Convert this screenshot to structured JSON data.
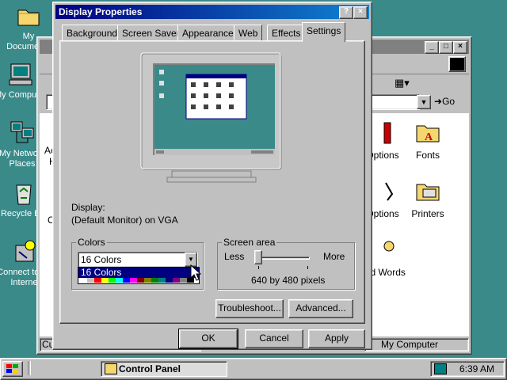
{
  "desktop": {
    "icons": [
      {
        "label": "My Documents"
      },
      {
        "label": "My Computer"
      },
      {
        "label": "My Network Places"
      },
      {
        "label": "Recycle Bin"
      },
      {
        "label": "Connect to the Internet"
      }
    ]
  },
  "control_panel_window": {
    "address_go": "Go",
    "items": [
      {
        "label": "Options"
      },
      {
        "label": "Fonts"
      },
      {
        "label": "Options"
      },
      {
        "label": "Printers"
      },
      {
        "label": "and Words"
      }
    ],
    "left_text_1": "Ac",
    "left_text_2": "H",
    "left_text_3": "C",
    "status_left": "Cus",
    "status_right": "My Computer"
  },
  "dialog": {
    "title": "Display Properties",
    "help_btn": "?",
    "close_btn": "×",
    "tabs": [
      "Background",
      "Screen Saver",
      "Appearance",
      "Web",
      "Effects",
      "Settings"
    ],
    "active_tab": "Settings",
    "display_label": "Display:",
    "display_value": "(Default Monitor) on VGA",
    "colors": {
      "group_label": "Colors",
      "selected": "16 Colors",
      "dropdown_item": "16 Colors",
      "palette": [
        "#ffffff",
        "#c0c0c0",
        "#ff0000",
        "#ffff00",
        "#00ff00",
        "#00ffff",
        "#0000ff",
        "#ff00ff",
        "#800000",
        "#808000",
        "#008000",
        "#008080",
        "#000080",
        "#800080",
        "#808080",
        "#000000"
      ]
    },
    "screen_area": {
      "group_label": "Screen area",
      "less": "Less",
      "more": "More",
      "value": "640 by 480 pixels",
      "slider_position": 0
    },
    "buttons": {
      "troubleshoot": "Troubleshoot...",
      "advanced": "Advanced...",
      "ok": "OK",
      "cancel": "Cancel",
      "apply": "Apply"
    }
  },
  "taskbar": {
    "task": "Control Panel",
    "clock": "6:39 AM"
  },
  "colors": {
    "desktop": "#3a8a8a",
    "title_active": "#000080",
    "face": "#c0c0c0"
  }
}
